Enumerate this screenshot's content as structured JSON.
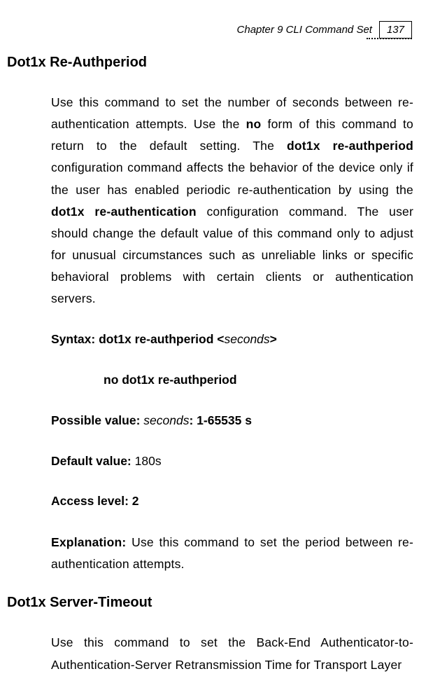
{
  "header": {
    "chapter": "Chapter 9 CLI Command Set",
    "page": "137"
  },
  "section1": {
    "title": "Dot1x Re-Authperiod",
    "description_1": "Use this command to set the number of seconds between re-authentication attempts. Use the ",
    "description_bold1": "no",
    "description_2": " form of this command to return to the default setting. The ",
    "description_bold2": "dot1x re-authperiod",
    "description_3": " configuration command affects the behavior of the device only if the user has enabled periodic re-authentication by using the ",
    "description_bold3": "dot1x re-authentication",
    "description_4": " configuration command. The user should change the default value of this command only to adjust for unusual circumstances such as unreliable links or specific behavioral problems with certain clients or authentication servers.",
    "syntax_label": "Syntax:  ",
    "syntax_cmd": "dot1x re-authperiod <",
    "syntax_param": "seconds",
    "syntax_close": ">",
    "syntax_no": "no dot1x re-authperiod",
    "possible_label": "Possible value: ",
    "possible_param": "seconds",
    "possible_val": ": 1-65535 s",
    "default_label": "Default value: ",
    "default_val": "180s",
    "access_label": "Access level: 2",
    "explanation_label": "Explanation: ",
    "explanation_text": "Use this command to set the period between re-authentication attempts."
  },
  "section2": {
    "title": "Dot1x Server-Timeout",
    "description": "Use this command to set the Back-End Authenticator-to-Authentication-Server Retransmission Time for Transport Layer"
  }
}
